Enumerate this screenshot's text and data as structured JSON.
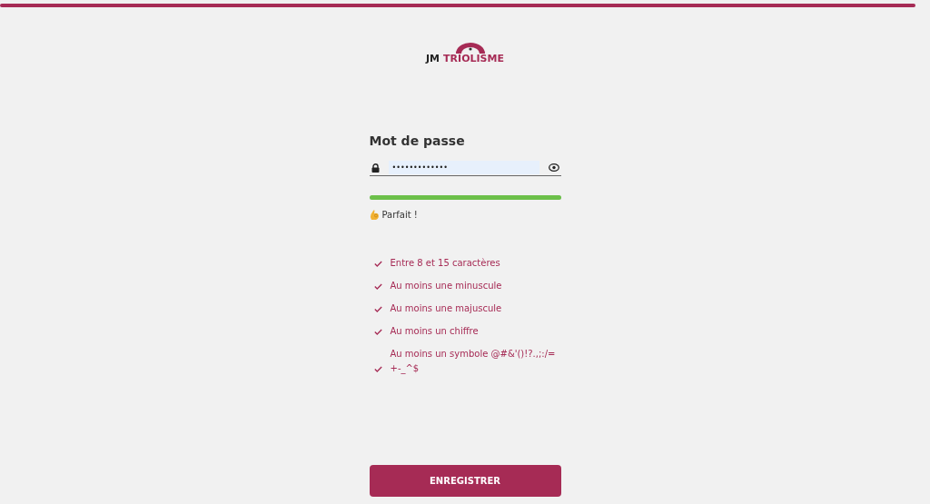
{
  "logo": {
    "prefix": "JM",
    "name": "TRIOLISME"
  },
  "form": {
    "title": "Mot de passe",
    "password": {
      "value": "•••••••••••••",
      "masked": true
    },
    "strength": {
      "level": 1,
      "label": "Parfait !"
    },
    "requirements": [
      {
        "text": "Entre 8 et 15 caractères",
        "met": true
      },
      {
        "text": "Au moins une minuscule",
        "met": true
      },
      {
        "text": "Au moins une majuscule",
        "met": true
      },
      {
        "text": "Au moins un chiffre",
        "met": true
      },
      {
        "text": "Au moins un symbole @#&'()!?.,;:/=+-_^$",
        "met": true
      }
    ],
    "submit": "ENREGISTRER"
  }
}
